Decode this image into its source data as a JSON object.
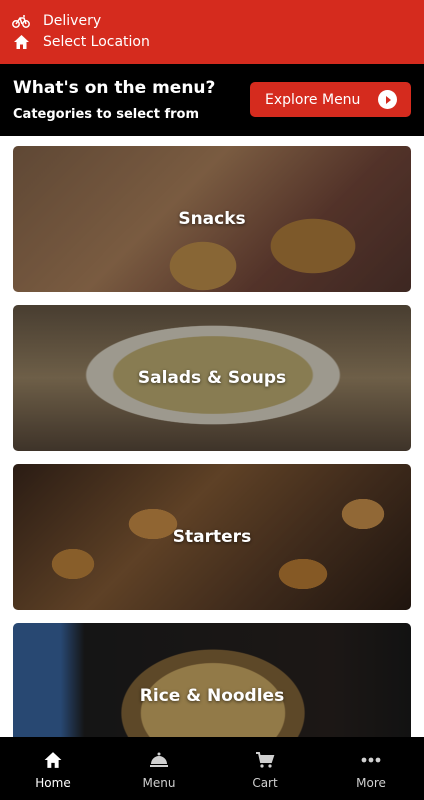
{
  "topbar": {
    "delivery_label": "Delivery",
    "location_label": "Select Location",
    "background_color": "#d52b1e",
    "icons": [
      "bicycle-icon",
      "home-icon"
    ]
  },
  "menu_header": {
    "title": "What's on the menu?",
    "subtitle": "Categories to select from",
    "explore_button": "Explore Menu",
    "explore_icon": "arrow-right-circle-icon"
  },
  "categories": [
    {
      "label": "Snacks"
    },
    {
      "label": "Salads & Soups"
    },
    {
      "label": "Starters"
    },
    {
      "label": "Rice & Noodles"
    }
  ],
  "tabs": [
    {
      "label": "Home",
      "icon": "home-icon",
      "active": true
    },
    {
      "label": "Menu",
      "icon": "cloche-icon",
      "active": false
    },
    {
      "label": "Cart",
      "icon": "cart-icon",
      "active": false
    },
    {
      "label": "More",
      "icon": "more-dots-icon",
      "active": false
    }
  ]
}
